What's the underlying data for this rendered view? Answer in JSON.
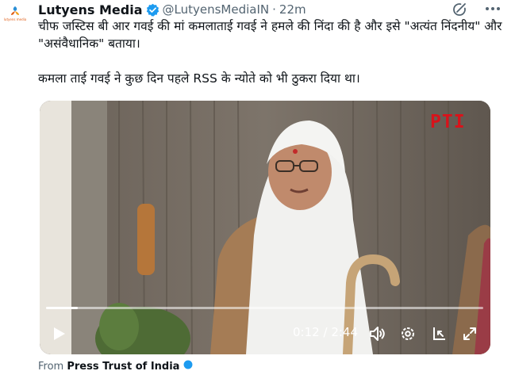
{
  "post": {
    "author_name": "Lutyens Media",
    "handle": "@LutyensMediaIN",
    "separator": "·",
    "time_ago": "22m",
    "avatar_caption": "lutyens media",
    "text_line_1": "चीफ जस्टिस बी आर गवई की मां कमलाताई गवई ने हमले की निंदा की है और इसे \"अत्यंत निंदनीय\" और \"असंवैधानिक\" बताया।",
    "text_line_2": "कमला ताई गवई ने कुछ दिन पहले RSS के न्योते को भी ठुकरा दिया था।"
  },
  "video": {
    "watermark": "PTI",
    "current_time": "0:12",
    "time_separator": "/",
    "duration": "2:44",
    "progress_fraction": 0.073
  },
  "source": {
    "prefix": "From",
    "name": "Press Trust of India"
  },
  "colors": {
    "verified_blue": "#1d9bf0",
    "text_primary": "#0f1419",
    "text_secondary": "#536471",
    "watermark_red": "#d8131b"
  },
  "icons": [
    "verified-badge-icon",
    "grok-icon",
    "more-icon",
    "play-icon",
    "volume-icon",
    "settings-icon",
    "picture-in-picture-icon",
    "fullscreen-icon"
  ]
}
